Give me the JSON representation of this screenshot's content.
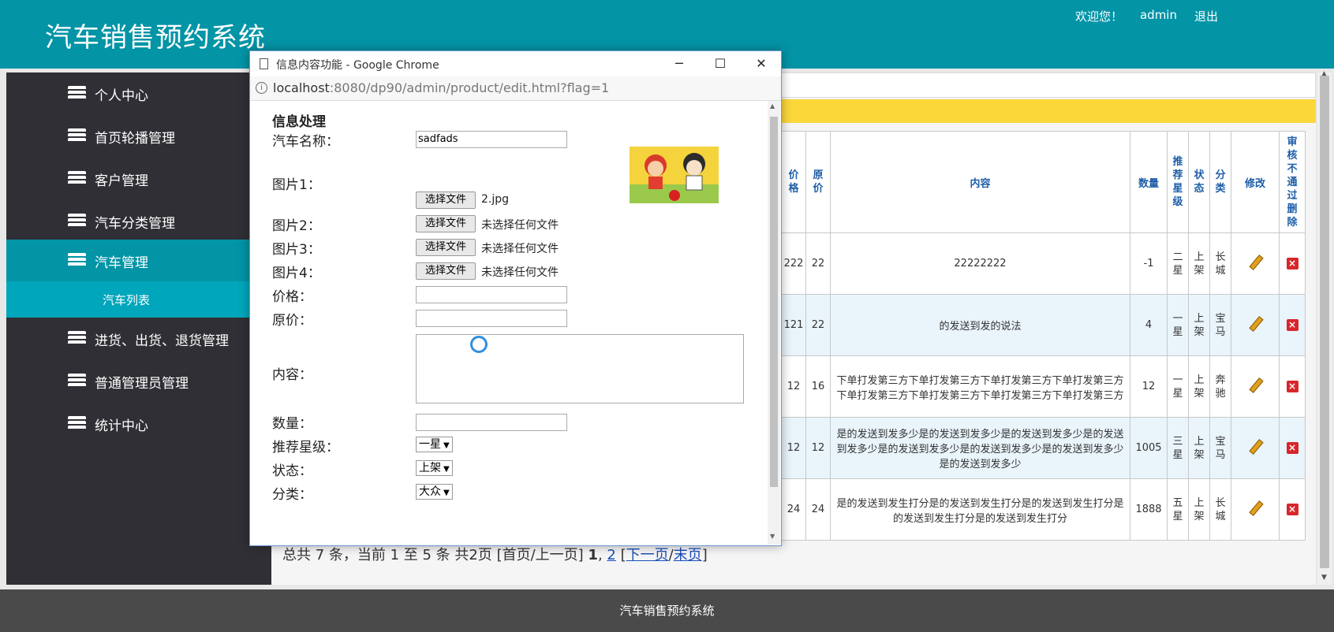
{
  "header": {
    "title": "汽车销售预约系统",
    "welcome": "欢迎您！",
    "user": "admin",
    "logout": "退出"
  },
  "sidebar": {
    "items": [
      {
        "label": "个人中心"
      },
      {
        "label": "首页轮播管理"
      },
      {
        "label": "客户管理"
      },
      {
        "label": "汽车分类管理"
      },
      {
        "label": "汽车管理"
      },
      {
        "label": "进货、出货、退货管理"
      },
      {
        "label": "普通管理员管理"
      },
      {
        "label": "统计中心"
      }
    ],
    "sub_item": "汽车列表"
  },
  "table": {
    "headers": [
      "价格",
      "原价",
      "内容",
      "数量",
      "推荐星级",
      "状态",
      "分类",
      "修改",
      "审核不通过删除"
    ],
    "rows": [
      {
        "price": "222",
        "orig": "22",
        "content": "22222222",
        "qty": "-1",
        "star": "二星",
        "status": "上架",
        "cat": "长城"
      },
      {
        "price": "121",
        "orig": "22",
        "content": "的发送到发的说法",
        "qty": "4",
        "star": "一星",
        "status": "上架",
        "cat": "宝马"
      },
      {
        "price": "12",
        "orig": "16",
        "content": "下单打发第三方下单打发第三方下单打发第三方下单打发第三方下单打发第三方下单打发第三方下单打发第三方下单打发第三方",
        "qty": "12",
        "star": "一星",
        "status": "上架",
        "cat": "奔驰"
      },
      {
        "price": "12",
        "orig": "12",
        "content": "是的发送到发多少是的发送到发多少是的发送到发多少是的发送到发多少是的发送到发多少是的发送到发多少是的发送到发多少是的发送到发多少",
        "qty": "1005",
        "star": "三星",
        "status": "上架",
        "cat": "宝马"
      },
      {
        "price": "24",
        "orig": "24",
        "content": "是的发送到发生打分是的发送到发生打分是的发送到发生打分是的发送到发生打分是的发送到发生打分",
        "qty": "1888",
        "star": "五星",
        "status": "上架",
        "cat": "长城"
      }
    ]
  },
  "pagination": {
    "summary": "总共 7 条，当前 1 至 5 条 共2页  [首页/上一页] ",
    "current": "1",
    "sep": ", ",
    "page2": "2",
    "open": " [",
    "next": "下一页",
    "slash": "/",
    "last": "末页",
    "close": "]"
  },
  "footer": "汽车销售预约系统",
  "popup": {
    "window_title": "信息内容功能 - Google Chrome",
    "url_host": "localhost",
    "url_path": ":8080/dp90/admin/product/edit.html?flag=1",
    "section_title": "信息处理",
    "labels": {
      "name": "汽车名称：",
      "img1": "图片1：",
      "img2": "图片2：",
      "img3": "图片3：",
      "img4": "图片4：",
      "price": "价格：",
      "orig": "原价：",
      "content": "内容：",
      "qty": "数量：",
      "star": "推荐星级：",
      "status": "状态：",
      "cat": "分类："
    },
    "name_value": "sadfads",
    "file_button": "选择文件",
    "img1_file": "2.jpg",
    "no_file": "未选择任何文件",
    "star_value": "一星",
    "status_value": "上架",
    "cat_value": "大众"
  }
}
